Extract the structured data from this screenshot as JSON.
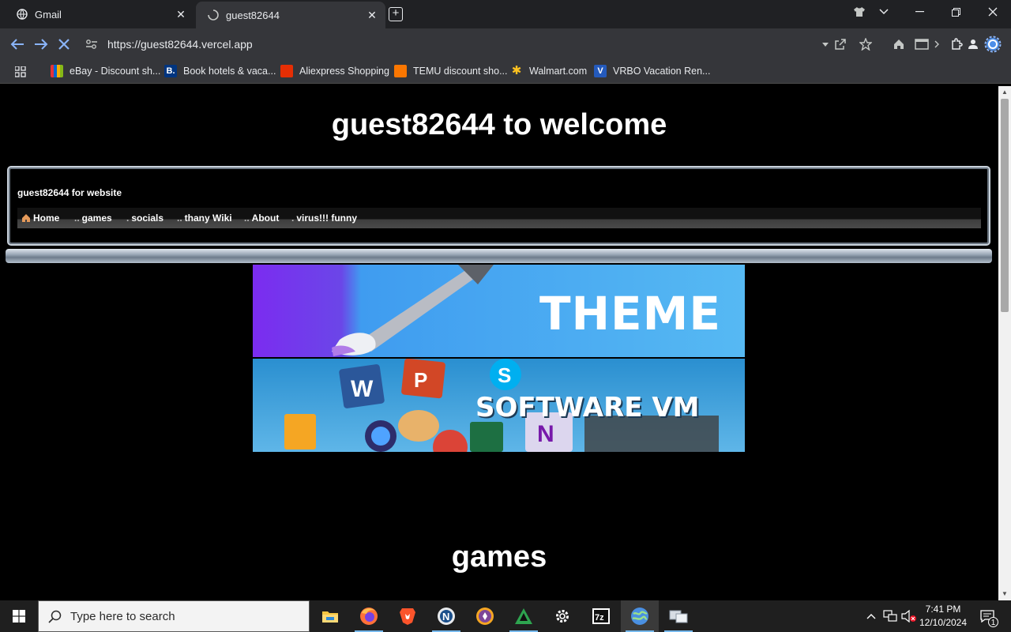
{
  "browser": {
    "tabs": [
      {
        "title": "Gmail",
        "favicon": "globe-icon",
        "active": false
      },
      {
        "title": "guest82644",
        "favicon": "loading-icon",
        "active": true
      }
    ],
    "url": "https://guest82644.vercel.app",
    "bookmarks": [
      {
        "label": "eBay - Discount sh...",
        "icon": "ebay-icon",
        "color": "#e53238"
      },
      {
        "label": "Book hotels & vaca...",
        "icon": "booking-icon",
        "color": "#003580"
      },
      {
        "label": "Aliexpress Shopping",
        "icon": "aliexpress-icon",
        "color": "#e62e04"
      },
      {
        "label": "TEMU discount sho...",
        "icon": "temu-icon",
        "color": "#fb7701"
      },
      {
        "label": "Walmart.com",
        "icon": "walmart-icon",
        "color": "#ffc220"
      },
      {
        "label": "VRBO Vacation Ren...",
        "icon": "vrbo-icon",
        "color": "#245abc"
      }
    ]
  },
  "page": {
    "title": "guest82644 to welcome",
    "site_name": "guest82644 for website",
    "nav": [
      {
        "label": "Home",
        "prefix": ""
      },
      {
        "label": "games",
        "prefix": ".."
      },
      {
        "label": "socials",
        "prefix": "."
      },
      {
        "label": "thany Wiki",
        "prefix": ".."
      },
      {
        "label": "About",
        "prefix": ".."
      },
      {
        "label": "virus!!! funny",
        "prefix": "."
      }
    ],
    "banners": [
      {
        "label": "THEME"
      },
      {
        "label": "SOFTWARE VM"
      }
    ],
    "section_title": "games"
  },
  "taskbar": {
    "search_placeholder": "Type here to search",
    "time": "7:41 PM",
    "date": "12/10/2024",
    "notification_count": "1"
  }
}
